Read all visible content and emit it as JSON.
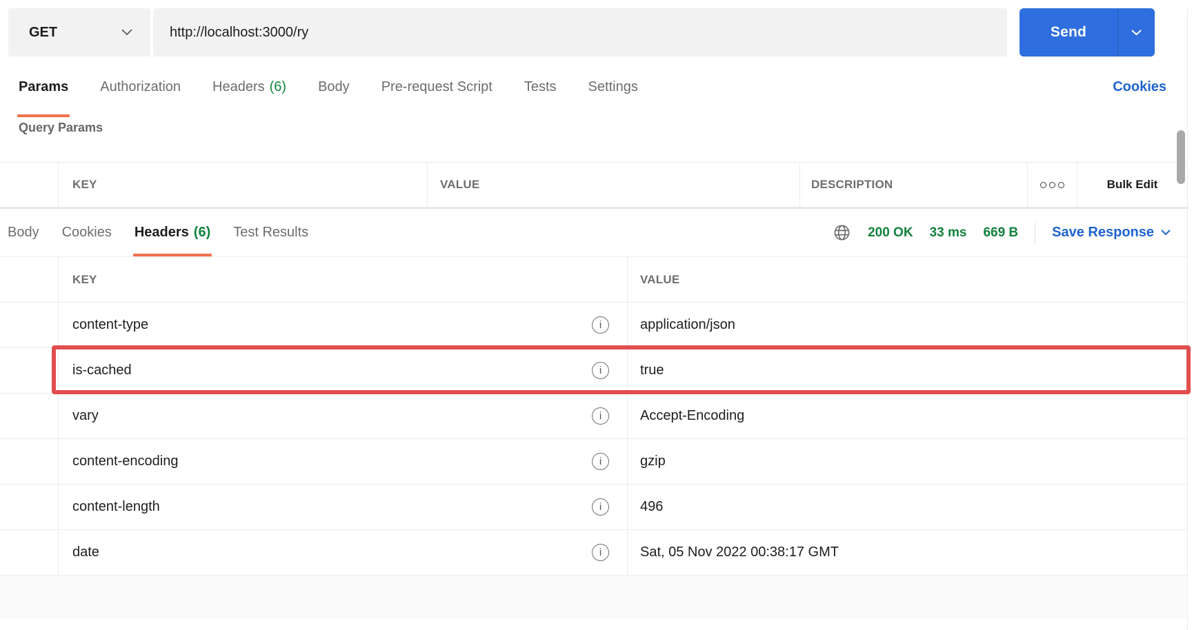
{
  "request_bar": {
    "method": "GET",
    "url": "http://localhost:3000/ry",
    "send_label": "Send"
  },
  "request_tabs": {
    "items": [
      {
        "label": "Params",
        "active": true
      },
      {
        "label": "Authorization"
      },
      {
        "label": "Headers",
        "count": "(6)"
      },
      {
        "label": "Body"
      },
      {
        "label": "Pre-request Script"
      },
      {
        "label": "Tests"
      },
      {
        "label": "Settings"
      }
    ],
    "cookies_link": "Cookies"
  },
  "query_params": {
    "title": "Query Params",
    "columns": {
      "key": "KEY",
      "value": "VALUE",
      "description": "DESCRIPTION"
    },
    "bulk_edit_label": "Bulk Edit"
  },
  "response_section": {
    "tabs": [
      {
        "label": "Body"
      },
      {
        "label": "Cookies"
      },
      {
        "label": "Headers",
        "count": "(6)",
        "active": true
      },
      {
        "label": "Test Results"
      }
    ],
    "status": {
      "code": "200 OK",
      "time": "33 ms",
      "size": "669 B"
    },
    "save_response_label": "Save Response",
    "headers_table": {
      "columns": {
        "key": "KEY",
        "value": "VALUE"
      },
      "rows": [
        {
          "key": "content-type",
          "value": "application/json",
          "highlighted": false
        },
        {
          "key": "is-cached",
          "value": "true",
          "highlighted": true
        },
        {
          "key": "vary",
          "value": "Accept-Encoding",
          "highlighted": false
        },
        {
          "key": "content-encoding",
          "value": "gzip",
          "highlighted": false
        },
        {
          "key": "content-length",
          "value": "496",
          "highlighted": false
        },
        {
          "key": "date",
          "value": "Sat, 05 Nov 2022 00:38:17 GMT",
          "highlighted": false
        }
      ]
    }
  },
  "icons": {
    "method_dropdown": "chevron-down",
    "send_dropdown": "chevron-down",
    "params_more": "more-options-dots",
    "response_network": "globe",
    "row_info": "info-circle",
    "save_dropdown": "chevron-down"
  },
  "colors": {
    "accent_orange": "#f0714b",
    "send_blue": "#2e6edf",
    "link_blue": "#1e63d0",
    "success_green": "#12823d",
    "highlight_red": "#e04e4e",
    "field_gray": "#f2f2f2",
    "text_dark": "#212121",
    "text_gray": "#6d6d6d"
  }
}
